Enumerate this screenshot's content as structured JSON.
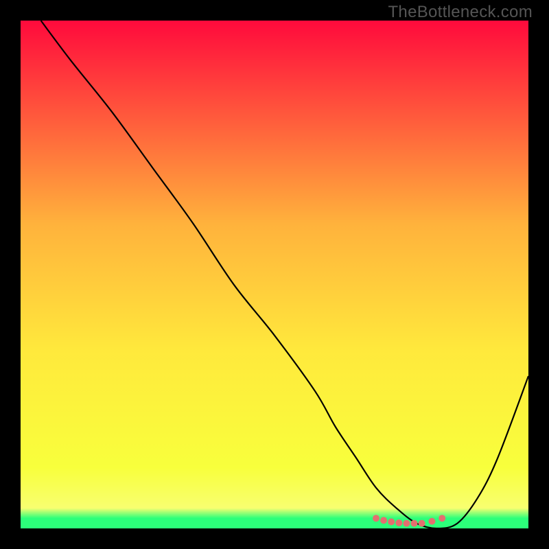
{
  "watermark": "TheBottleneck.com",
  "colors": {
    "gradient_top": "#ff0a3c",
    "gradient_q1": "#ffb23c",
    "gradient_mid": "#ffe93c",
    "gradient_q3": "#f8ff3c",
    "gradient_bot_yellow": "#f8ff70",
    "gradient_green": "#2cff7a",
    "curve": "#000000",
    "dots": "#e46f6f"
  },
  "chart_data": {
    "type": "line",
    "title": "",
    "xlabel": "",
    "ylabel": "",
    "xlim": [
      0,
      100
    ],
    "ylim": [
      0,
      100
    ],
    "series": [
      {
        "name": "bottleneck-curve",
        "x": [
          4,
          10,
          18,
          26,
          34,
          42,
          50,
          58,
          62,
          66,
          70,
          74,
          78,
          82,
          86,
          90,
          94,
          100
        ],
        "y": [
          100,
          92,
          82,
          71,
          60,
          48,
          38,
          27,
          20,
          14,
          8,
          4,
          1,
          0,
          1,
          6,
          14,
          30
        ]
      }
    ],
    "markers": {
      "name": "highlight-dots",
      "x": [
        70,
        71.5,
        73,
        74.5,
        76,
        77.5,
        79,
        81,
        83
      ],
      "y": [
        2.0,
        1.6,
        1.3,
        1.1,
        1.0,
        1.0,
        1.0,
        1.4,
        2.0
      ]
    }
  }
}
